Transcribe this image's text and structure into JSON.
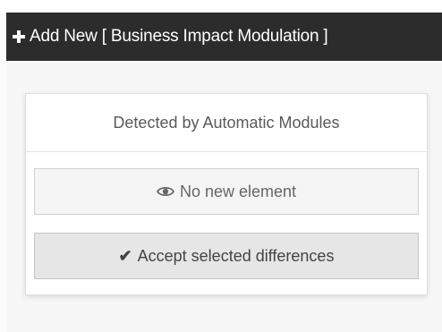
{
  "header": {
    "icon": "plus-icon",
    "title": "Add New [ Business Impact Modulation ]"
  },
  "panel": {
    "heading": "Detected by Automatic Modules",
    "no_new_button": {
      "icon": "eye-icon",
      "label": "No new element"
    },
    "accept_button": {
      "icon": "check-icon",
      "label": "Accept selected differences"
    }
  },
  "colors": {
    "header_bg": "#2c2c2c",
    "header_text": "#ffffff",
    "page_bg": "#f7f7f7",
    "panel_bg": "#ffffff",
    "button_bg": "#f5f5f5",
    "accept_bg": "#e6e6e6"
  }
}
